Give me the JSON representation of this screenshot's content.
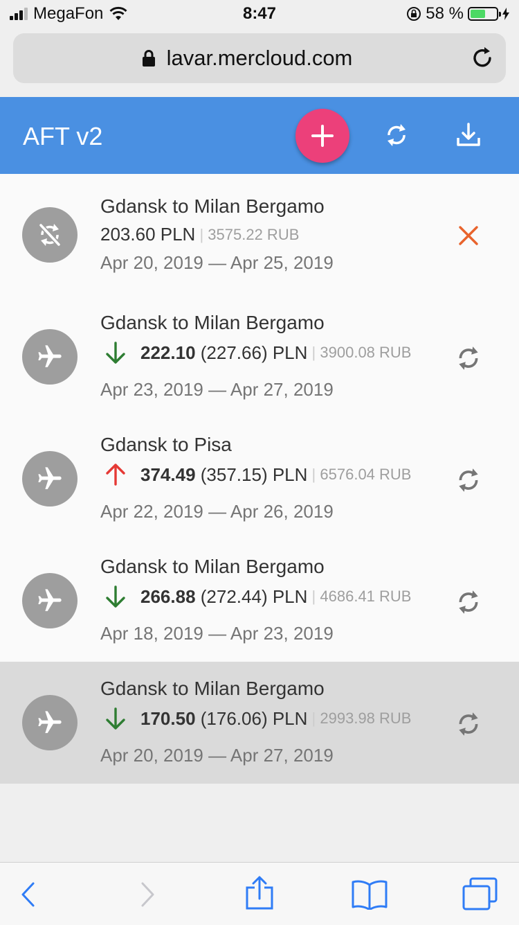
{
  "status_bar": {
    "carrier": "MegaFon",
    "time": "8:47",
    "battery_percent": "58 %",
    "battery_level": 0.58,
    "signal_bars": 3
  },
  "browser": {
    "url": "lavar.mercloud.com"
  },
  "app": {
    "title": "AFT v2",
    "accent": "#4a90e2",
    "fab_color": "#ec407a"
  },
  "flights": [
    {
      "route": "Gdansk to Milan Bergamo",
      "status": "disabled",
      "price": "203.60 PLN",
      "rub": "3575.22 RUB",
      "dates": "Apr 20, 2019 — Apr 25, 2019",
      "action": "close-icon"
    },
    {
      "route": "Gdansk to Milan Bergamo",
      "status": "active",
      "trend": "down",
      "price": "222.10",
      "previous": "(227.66) PLN",
      "rub": "3900.08 RUB",
      "dates": "Apr 23, 2019 — Apr 27, 2019",
      "action": "refresh-icon"
    },
    {
      "route": "Gdansk to Pisa",
      "status": "active",
      "trend": "up",
      "price": "374.49",
      "previous": "(357.15) PLN",
      "rub": "6576.04 RUB",
      "dates": "Apr 22, 2019 — Apr 26, 2019",
      "action": "refresh-icon"
    },
    {
      "route": "Gdansk to Milan Bergamo",
      "status": "active",
      "trend": "down",
      "price": "266.88",
      "previous": "(272.44) PLN",
      "rub": "4686.41 RUB",
      "dates": "Apr 18, 2019 — Apr 23, 2019",
      "action": "refresh-icon"
    },
    {
      "route": "Gdansk to Milan Bergamo",
      "status": "active",
      "trend": "down",
      "price": "170.50",
      "previous": "(176.06) PLN",
      "rub": "2993.98 RUB",
      "dates": "Apr 20, 2019 — Apr 27, 2019",
      "action": "refresh-icon",
      "selected": true
    }
  ],
  "colors": {
    "down": "#2e7d32",
    "up": "#e53935",
    "close": "#e8632c"
  }
}
